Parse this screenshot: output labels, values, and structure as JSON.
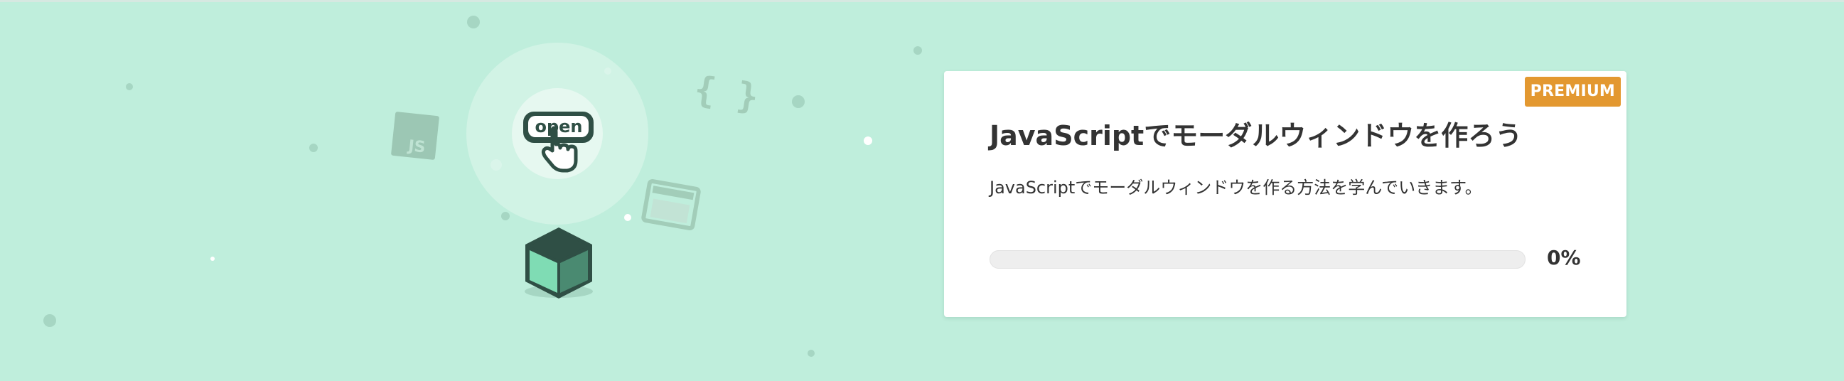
{
  "course": {
    "badge": "PREMIUM",
    "title": "JavaScriptでモーダルウィンドウを作ろう",
    "description": "JavaScriptでモーダルウィンドウを作る方法を学んでいきます。",
    "progress_label": "0%",
    "progress_fraction": 0
  },
  "illustration": {
    "button_text": "open",
    "js_tile_text": "JS",
    "braces_text": "{ }"
  },
  "colors": {
    "background": "#bfeedc",
    "badge": "#e39830",
    "card": "#ffffff",
    "text": "#333333",
    "cube_dark": "#2f4f45",
    "cube_face": "#7fdcb4"
  },
  "icons": [
    "open-button-icon",
    "hand-pointer-icon",
    "cube-icon",
    "js-file-icon",
    "curly-braces-icon",
    "window-icon"
  ]
}
